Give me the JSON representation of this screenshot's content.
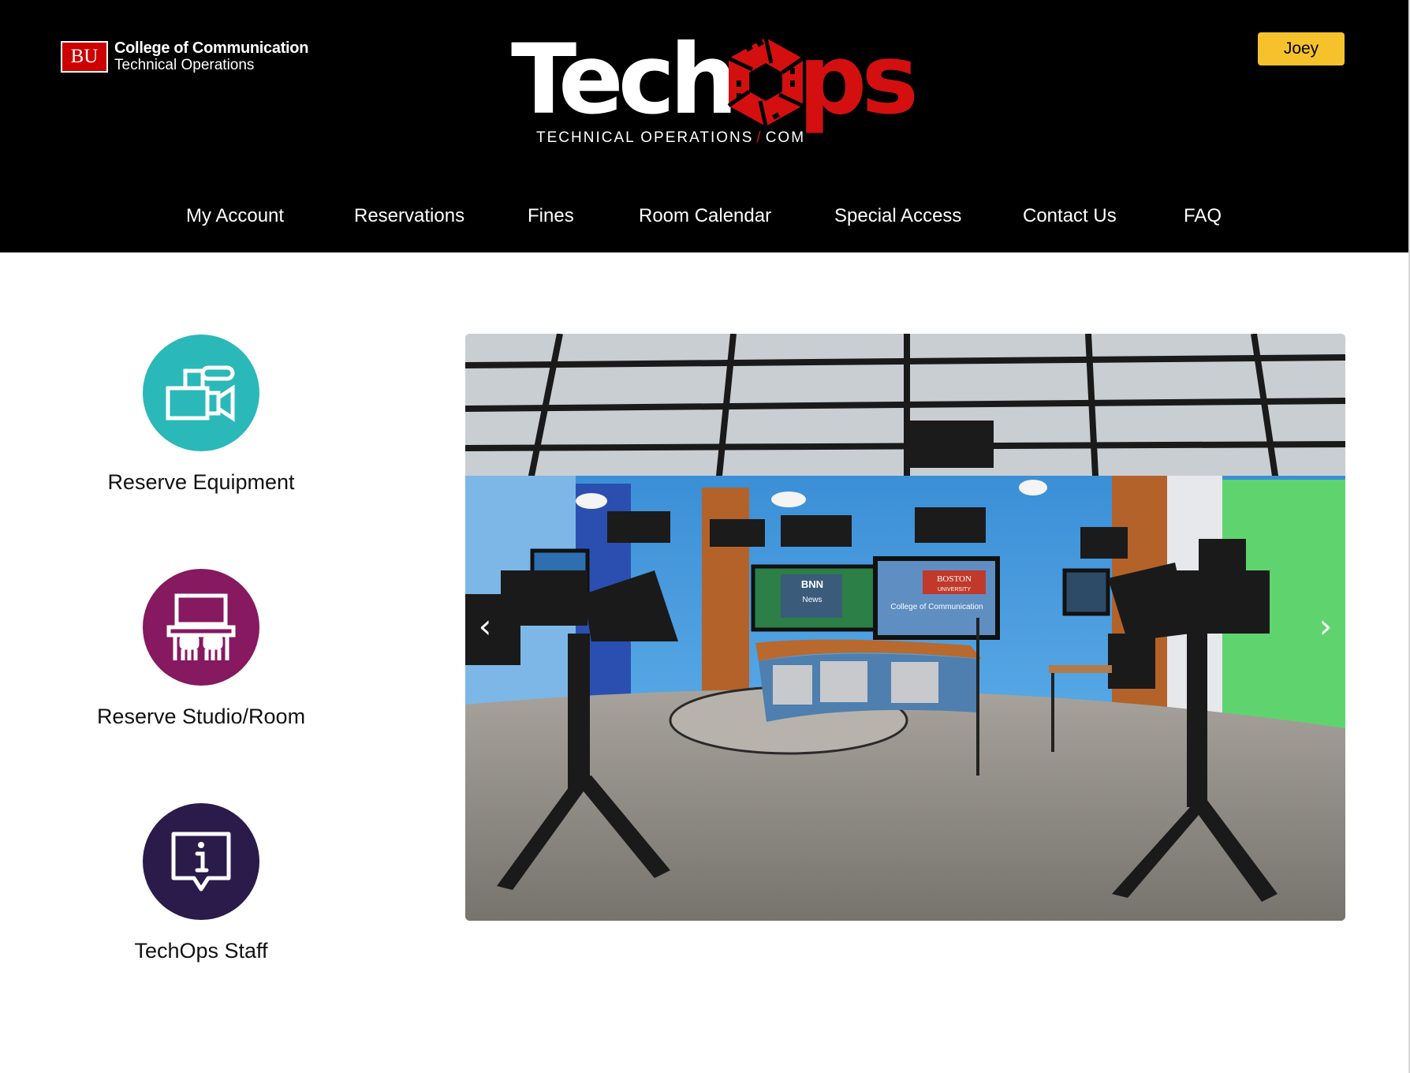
{
  "header": {
    "org_badge": "BU",
    "org_name": "College of Communication",
    "org_dept": "Technical Operations",
    "brand_tech": "Tech",
    "brand_ps": "ps",
    "brand_sub_left": "TECHNICAL OPERATIONS",
    "brand_sub_slash": "/",
    "brand_sub_right": "COM",
    "user_name": "Joey"
  },
  "nav": {
    "items": [
      {
        "label": "My Account"
      },
      {
        "label": "Reservations"
      },
      {
        "label": "Fines"
      },
      {
        "label": "Room Calendar"
      },
      {
        "label": "Special Access"
      },
      {
        "label": "Contact Us"
      },
      {
        "label": "FAQ"
      }
    ]
  },
  "actions": [
    {
      "label": "Reserve Equipment",
      "icon": "video-camera-icon",
      "color": "#2bb8b8"
    },
    {
      "label": "Reserve Studio/Room",
      "icon": "classroom-icon",
      "color": "#86195f"
    },
    {
      "label": "TechOps Staff",
      "icon": "info-icon",
      "color": "#2a1b4a"
    }
  ],
  "carousel": {
    "prev_glyph": "‹",
    "next_glyph": "›",
    "slide_text": {
      "screen_boston": "BOSTON",
      "screen_university": "UNIVERSITY",
      "screen_college": "College of Communication",
      "news_logo": "BNN",
      "news_word": "News"
    }
  },
  "colors": {
    "header_bg": "#000000",
    "brand_red": "#d40f0f",
    "user_button": "#f6c22c"
  }
}
